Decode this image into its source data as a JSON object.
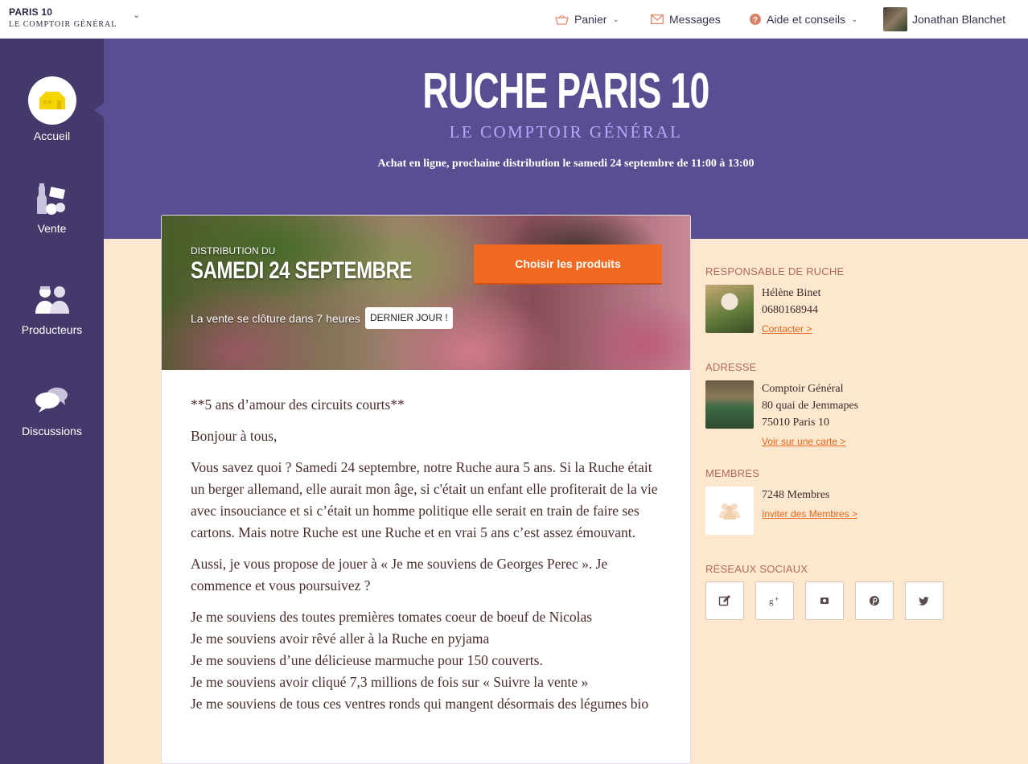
{
  "topbar": {
    "hive_name": "PARIS 10",
    "hive_sub": "LE COMPTOIR GÉNÉRAL",
    "cart_label": "Panier",
    "messages_label": "Messages",
    "help_label": "Aide et conseils",
    "user_name": "Jonathan Blanchet"
  },
  "sidebar": {
    "items": [
      {
        "label": "Accueil",
        "icon": "home-icon"
      },
      {
        "label": "Vente",
        "icon": "sale-icon"
      },
      {
        "label": "Producteurs",
        "icon": "producers-icon"
      },
      {
        "label": "Discussions",
        "icon": "discussions-icon"
      }
    ]
  },
  "hero": {
    "title": "RUCHE PARIS 10",
    "subtitle": "LE COMPTOIR GÉNÉRAL",
    "info": "Achat en ligne, prochaine distribution le samedi 24 septembre de 11:00 à 13:00"
  },
  "banner": {
    "distribution_label": "DISTRIBUTION DU",
    "date": "SAMEDI 24 SEPTEMBRE",
    "closing_text": "La vente se clôture dans 7 heures",
    "badge": "DERNIER JOUR !",
    "button": "Choisir les produits"
  },
  "article": {
    "paragraphs": [
      "**5 ans d’amour des circuits courts**",
      "Bonjour à tous,",
      "Vous savez quoi ? Samedi 24 septembre, notre Ruche aura 5 ans. Si la Ruche était un berger allemand, elle aurait mon âge, si c'était un enfant elle profiterait de la vie avec insouciance et si c’était un homme politique elle serait en train de faire ses cartons. Mais notre Ruche est une Ruche et en vrai 5 ans c’est assez émouvant.",
      "Aussi, je vous propose de jouer à « Je me souviens de Georges Perec ». Je commence et vous poursuivez ?"
    ],
    "memories": [
      "Je me souviens des toutes premières tomates coeur de boeuf de Nicolas",
      "Je me souviens avoir rêvé aller à la Ruche en pyjama",
      "Je me souviens d’une délicieuse marmuche pour 150 couverts.",
      "Je me souviens avoir cliqué 7,3 millions de fois sur « Suivre la vente »",
      "Je me souviens de tous ces ventres ronds qui mangent désormais des légumes bio"
    ]
  },
  "right": {
    "manager": {
      "heading": "RESPONSABLE DE RUCHE",
      "name": "Hélène Binet",
      "phone": "0680168944",
      "link": "Contacter >"
    },
    "address": {
      "heading": "ADRESSE",
      "line1": "Comptoir Général",
      "line2": "80 quai de Jemmapes",
      "line3": "75010 Paris 10",
      "link": "Voir sur une carte >"
    },
    "members": {
      "heading": "MEMBRES",
      "count": "7248 Membres",
      "link": "Inviter des Membres >"
    },
    "social": {
      "heading": "RÉSEAUX SOCIAUX",
      "icons": [
        "blog-icon",
        "google-plus-icon",
        "instagram-icon",
        "pinterest-icon",
        "twitter-icon"
      ]
    }
  },
  "colors": {
    "purple": "#5a4e92",
    "sidebar": "#45396b",
    "orange": "#f26a21",
    "cream": "#fde8cf"
  }
}
